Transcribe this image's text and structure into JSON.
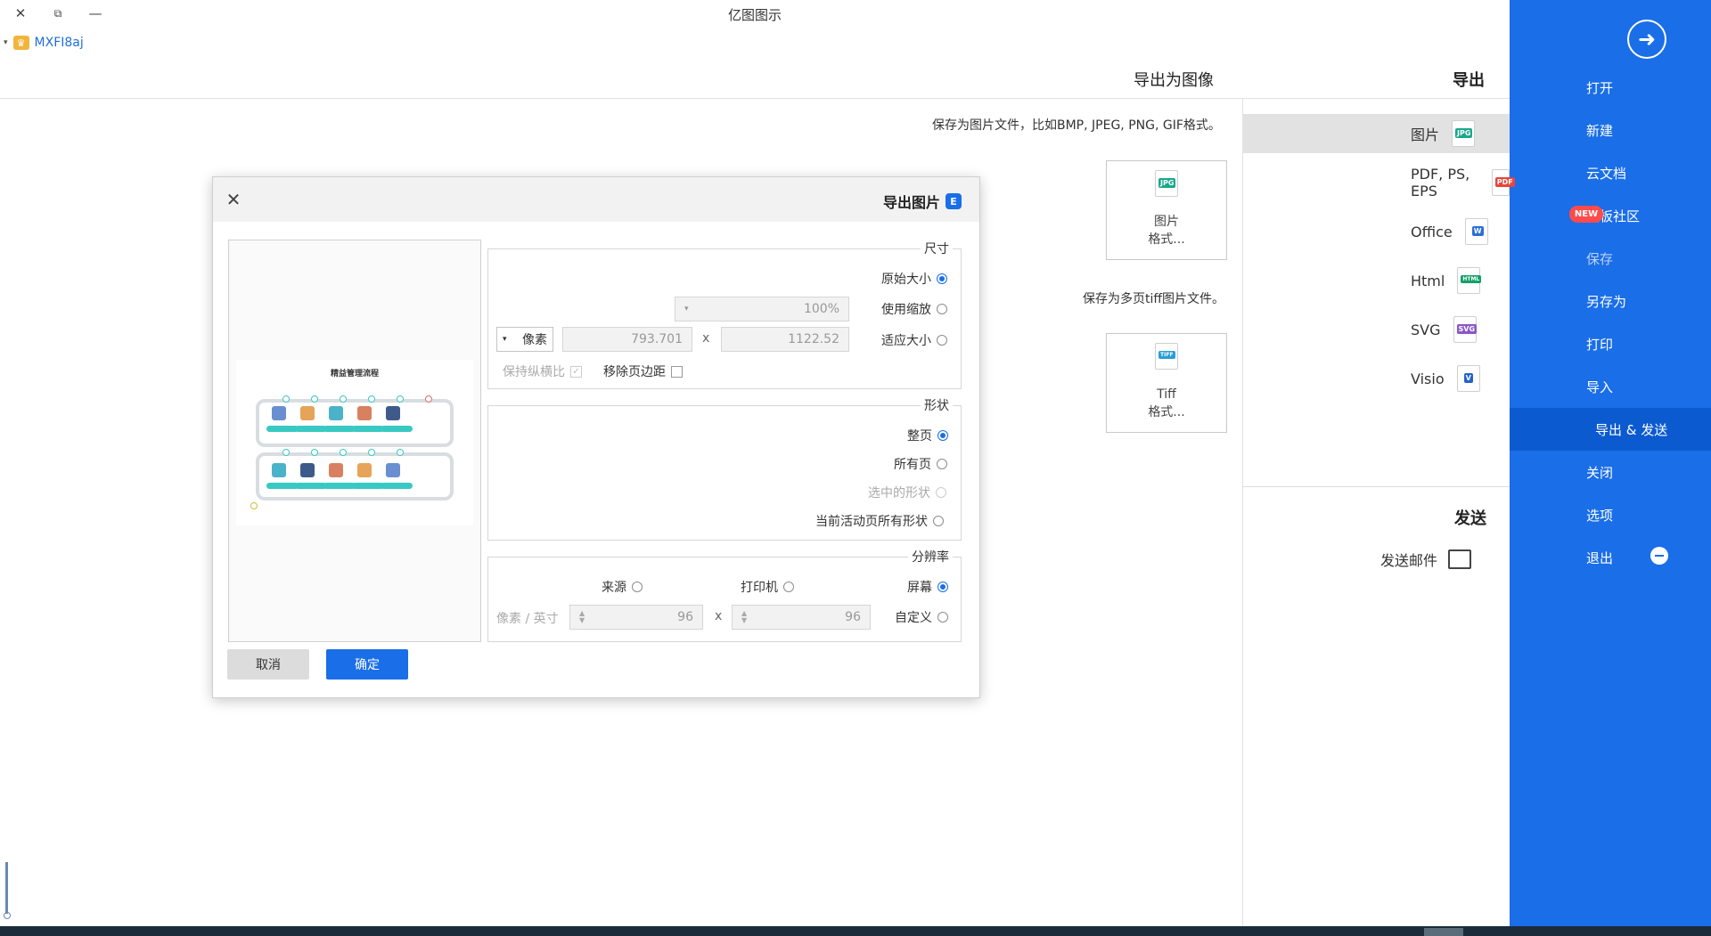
{
  "window": {
    "title": "亿图图示",
    "minimize": "—",
    "restore": "⧉",
    "close": "✕"
  },
  "user": {
    "name": "MXFI8aj",
    "vip_icon": "crown-icon",
    "dropdown": "▾"
  },
  "sidebar": {
    "back_icon": "arrow-right-circle-icon",
    "items": [
      {
        "label": "打开"
      },
      {
        "label": "新建"
      },
      {
        "label": "云文档"
      },
      {
        "label": "模板社区",
        "badge": "NEW"
      },
      {
        "label": "保存"
      },
      {
        "label": "另存为"
      },
      {
        "label": "打印"
      },
      {
        "label": "导入"
      },
      {
        "label": "导出 & 发送"
      },
      {
        "label": "关闭"
      },
      {
        "label": "选项"
      },
      {
        "label": "退出"
      }
    ]
  },
  "export": {
    "heading": "导出",
    "categories": [
      {
        "label": "图片",
        "icon": "JPG",
        "color": "#1aa88a"
      },
      {
        "label": "PDF, PS, EPS",
        "icon": "PDF",
        "color": "#e8453c"
      },
      {
        "label": "Office",
        "icon": "W",
        "color": "#2b6fd6"
      },
      {
        "label": "Html",
        "icon": "HTML",
        "color": "#14a06b"
      },
      {
        "label": "SVG",
        "icon": "SVG",
        "color": "#8a57c9"
      },
      {
        "label": "Visio",
        "icon": "V",
        "color": "#2563c7"
      }
    ],
    "send_heading": "发送",
    "send_mail": "发送邮件"
  },
  "content": {
    "heading": "导出为图像",
    "desc1": "保存为图片文件，比如BMP, JPEG, PNG, GIF格式。",
    "tile1": {
      "line1": "图片",
      "line2": "格式...",
      "icon": "JPG"
    },
    "desc2": "保存为多页tiff图片文件。",
    "tile2": {
      "line1": "Tiff",
      "line2": "格式...",
      "icon": "TIFF"
    }
  },
  "dialog": {
    "title": "导出图片",
    "icon": "E",
    "close": "✕",
    "preview": {
      "title": "精益管理流程"
    },
    "size": {
      "label": "尺寸",
      "original": "原始大小",
      "use_zoom": "使用缩放",
      "zoom_value": "100%",
      "fit": "适应大小",
      "width": "1122.52",
      "times": "x",
      "height": "793.701",
      "unit": "像素",
      "remove_margin": "移除页边距",
      "keep_ratio": "保持纵横比"
    },
    "shape": {
      "label": "形状",
      "whole": "整页",
      "all": "所有页",
      "selected": "选中的形状",
      "current_all": "当前活动页所有形状"
    },
    "resolution": {
      "label": "分辨率",
      "screen": "屏幕",
      "printer": "打印机",
      "source": "来源",
      "custom": "自定义",
      "x_value": "96",
      "times": "x",
      "y_value": "96",
      "unit": "像素 / 英寸"
    },
    "ok": "确定",
    "cancel": "取消"
  }
}
